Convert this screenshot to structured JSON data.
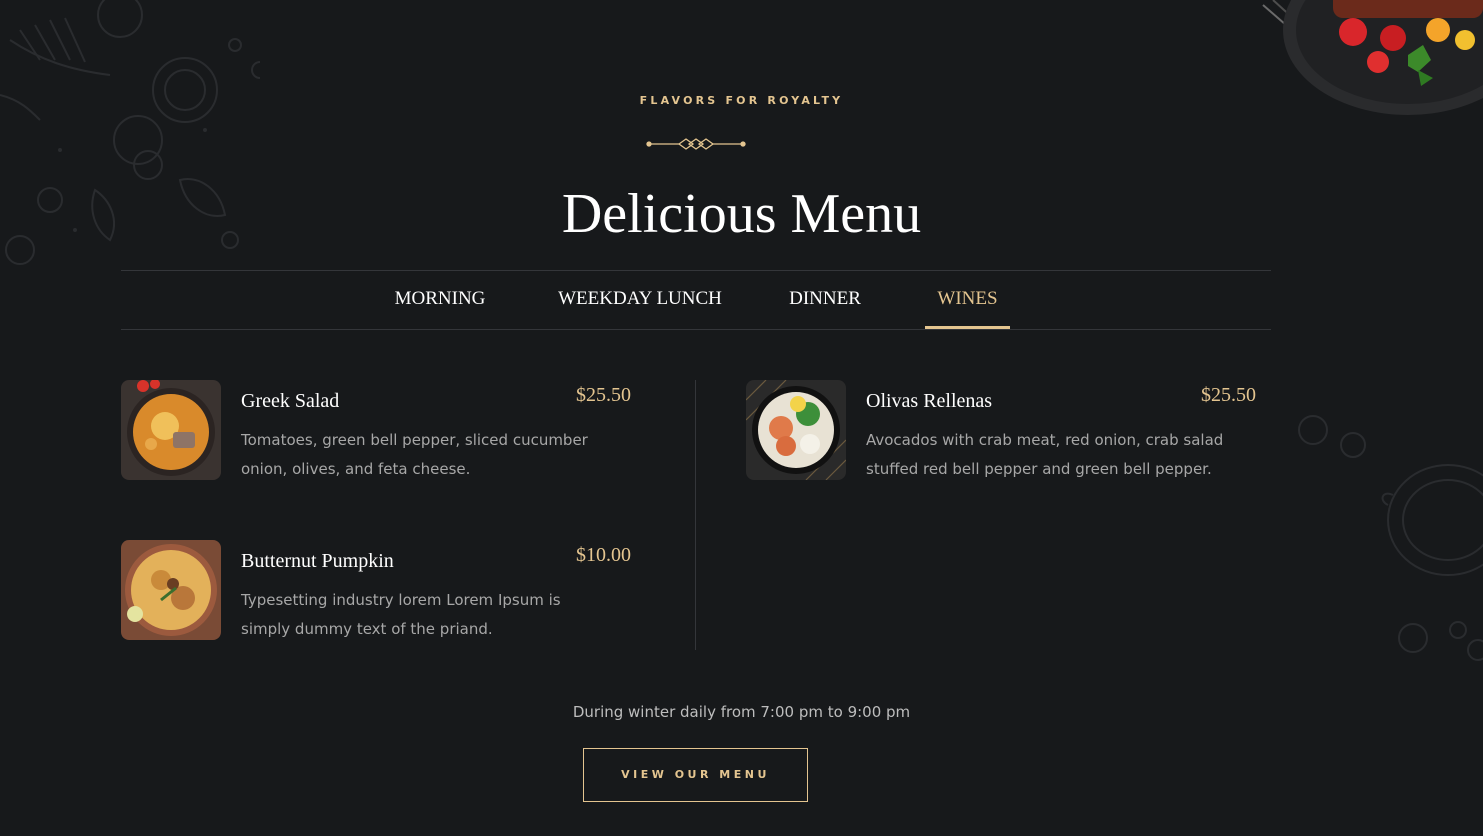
{
  "section": {
    "tagline": "FLAVORS FOR ROYALTY",
    "title": "Delicious Menu"
  },
  "tabs": [
    {
      "label": "MORNING",
      "active": false
    },
    {
      "label": "WEEKDAY LUNCH",
      "active": false
    },
    {
      "label": "DINNER",
      "active": false
    },
    {
      "label": "WINES",
      "active": true
    }
  ],
  "menu": {
    "left": [
      {
        "name": "Greek Salad",
        "price": "$25.50",
        "description": "Tomatoes, green bell pepper, sliced cucumber onion, olives, and feta cheese."
      },
      {
        "name": "Butternut Pumpkin",
        "price": "$10.00",
        "description": "Typesetting industry lorem Lorem Ipsum is simply dummy text of the priand."
      }
    ],
    "right": [
      {
        "name": "Olivas Rellenas",
        "price": "$25.50",
        "description": "Avocados with crab meat, red onion, crab salad stuffed red bell pepper and green bell pepper."
      }
    ]
  },
  "footer": {
    "hours": "During winter daily from 7:00 pm to 9:00 pm",
    "cta_label": "VIEW OUR MENU"
  },
  "colors": {
    "background": "#17191b",
    "accent": "#e4c590",
    "text": "#ffffff",
    "muted": "#a7a7a7"
  }
}
